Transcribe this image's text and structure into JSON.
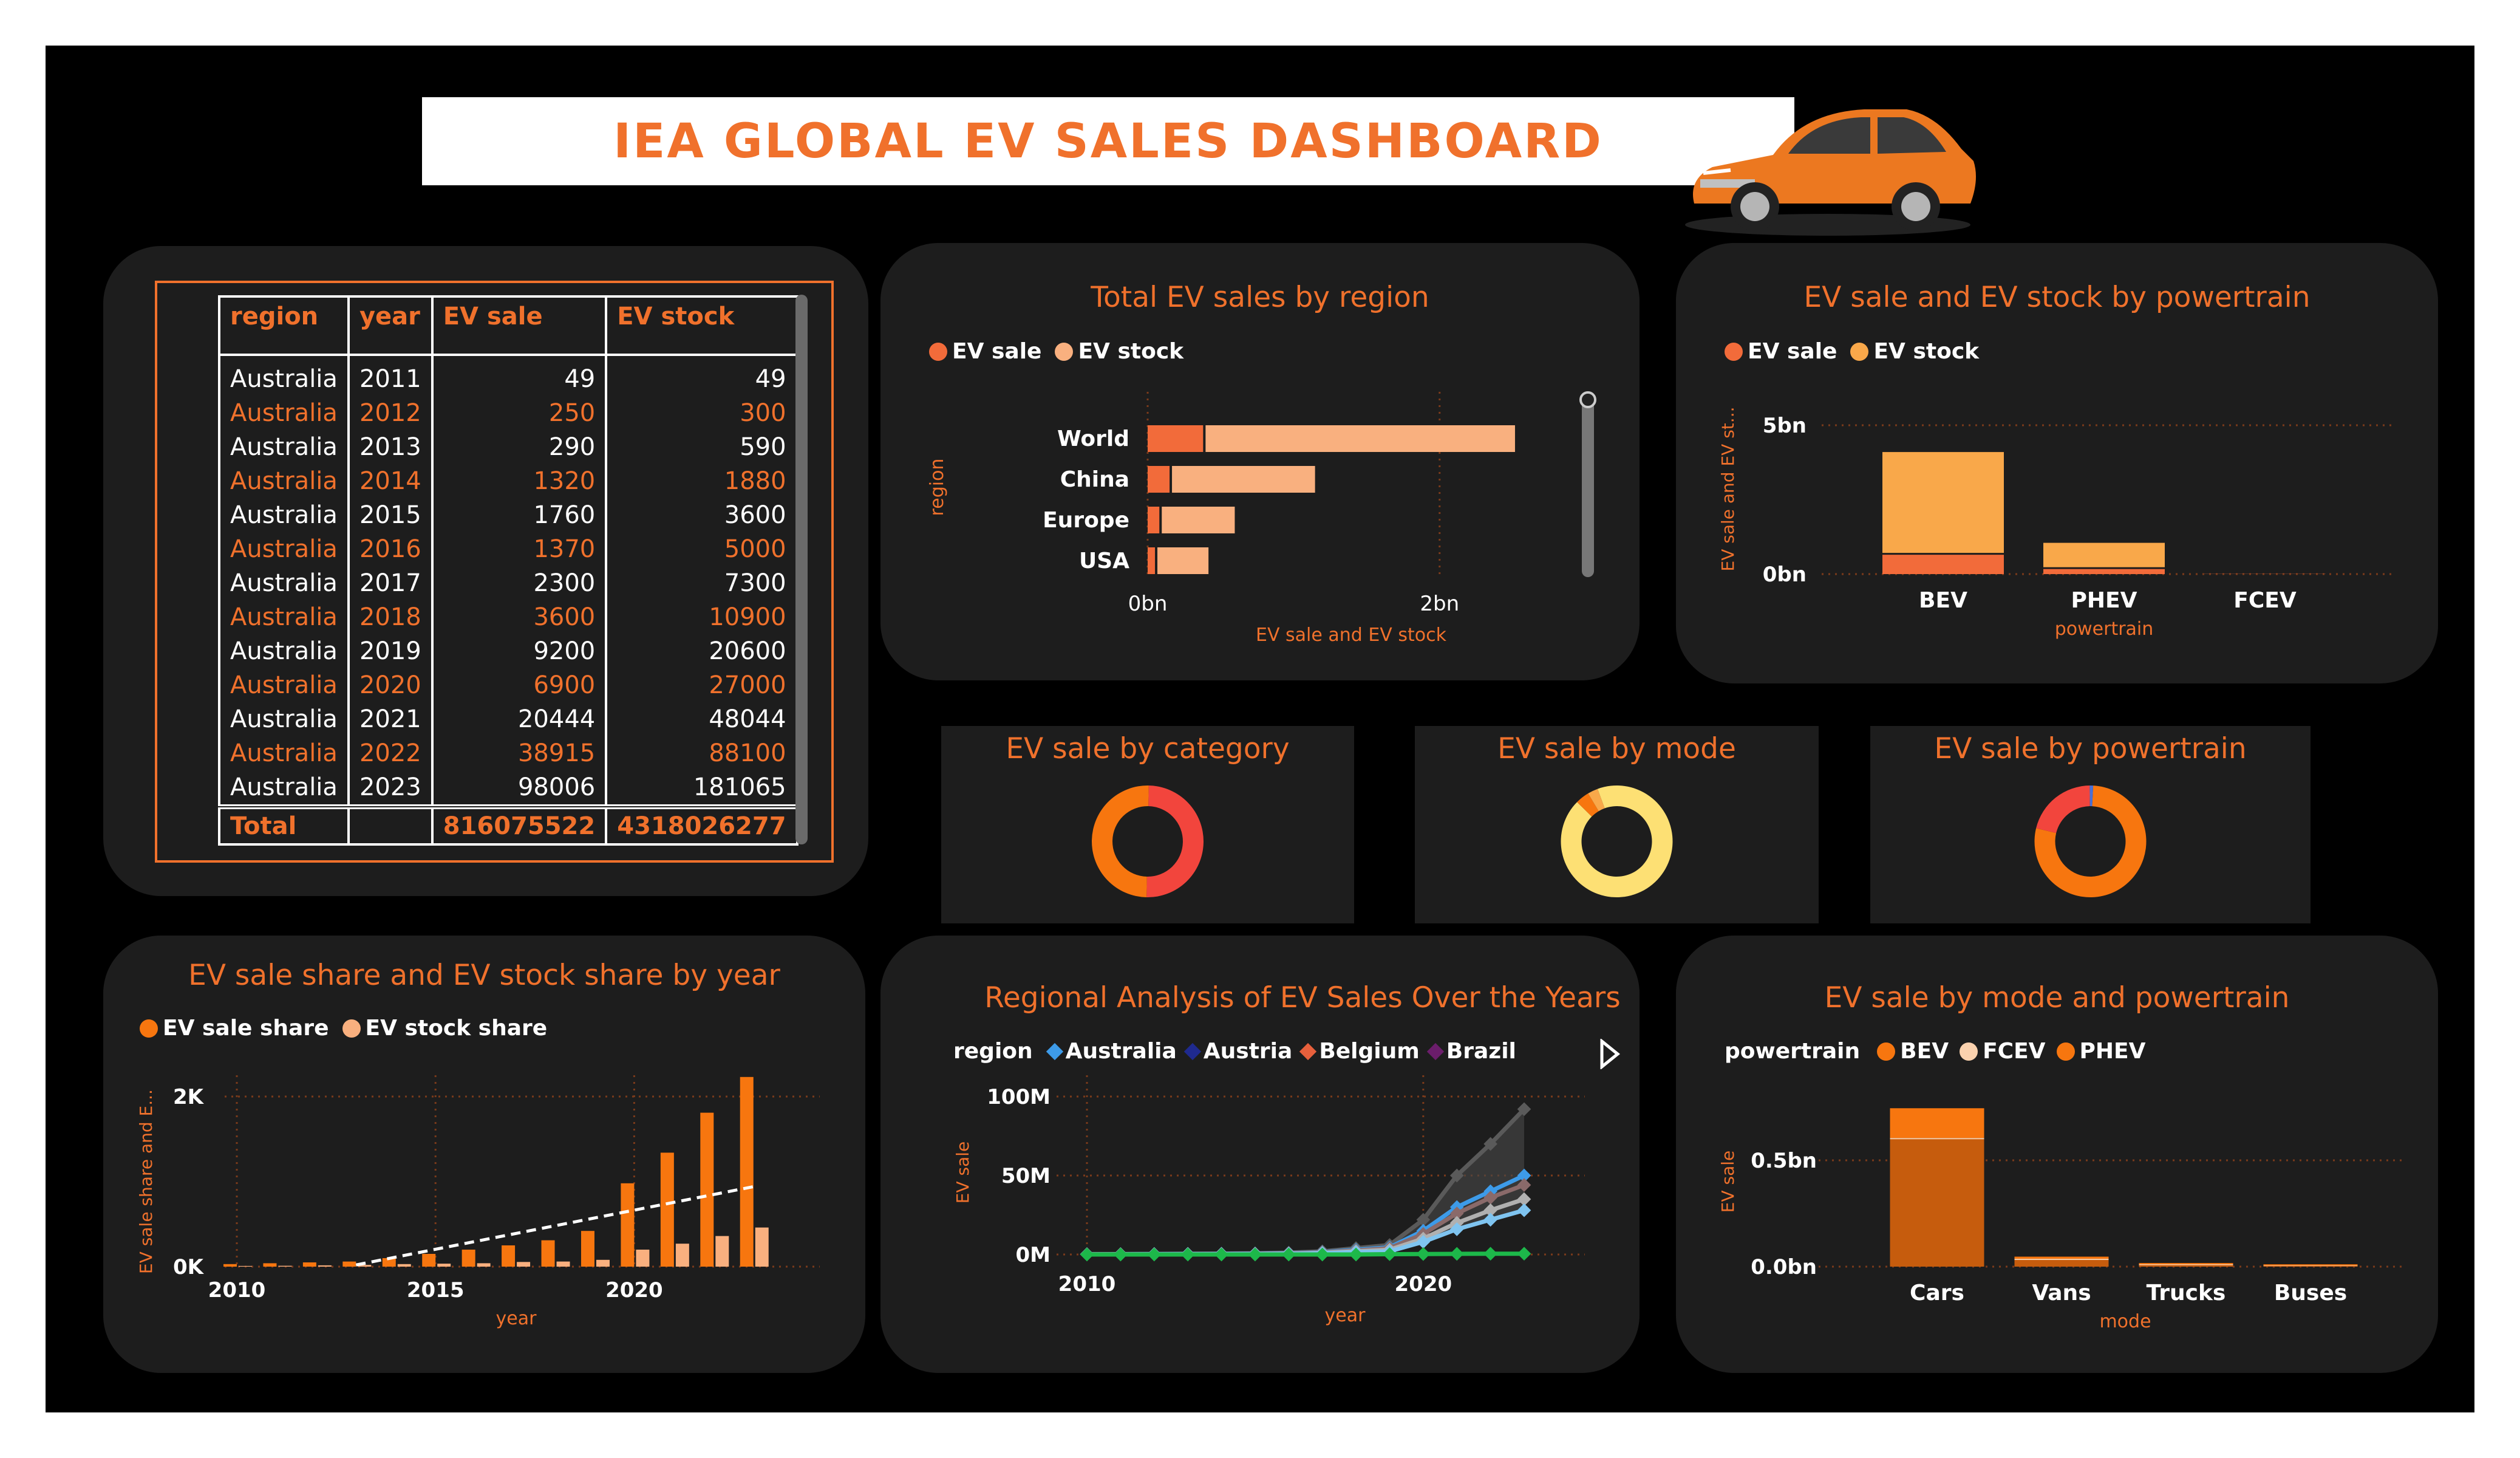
{
  "header": {
    "title": "IEA GLOBAL EV SALES DASHBOARD"
  },
  "colors": {
    "accent": "#f0712c",
    "panel": "#1d1d1d",
    "background": "#000000"
  },
  "table": {
    "columns": [
      "region",
      "year",
      "EV sale",
      "EV stock"
    ],
    "rows": [
      [
        "Australia",
        "2011",
        "49",
        "49"
      ],
      [
        "Australia",
        "2012",
        "250",
        "300"
      ],
      [
        "Australia",
        "2013",
        "290",
        "590"
      ],
      [
        "Australia",
        "2014",
        "1320",
        "1880"
      ],
      [
        "Australia",
        "2015",
        "1760",
        "3600"
      ],
      [
        "Australia",
        "2016",
        "1370",
        "5000"
      ],
      [
        "Australia",
        "2017",
        "2300",
        "7300"
      ],
      [
        "Australia",
        "2018",
        "3600",
        "10900"
      ],
      [
        "Australia",
        "2019",
        "9200",
        "20600"
      ],
      [
        "Australia",
        "2020",
        "6900",
        "27000"
      ],
      [
        "Australia",
        "2021",
        "20444",
        "48044"
      ],
      [
        "Australia",
        "2022",
        "38915",
        "88100"
      ],
      [
        "Australia",
        "2023",
        "98006",
        "181065"
      ]
    ],
    "total": {
      "label": "Total",
      "ev_sale": "816075522",
      "ev_stock": "4318026277"
    }
  },
  "chart_data": [
    {
      "id": "region",
      "type": "bar",
      "orientation": "horizontal",
      "title": "Total EV sales by region",
      "categories": [
        "World",
        "China",
        "Europe",
        "USA"
      ],
      "series": [
        {
          "name": "EV sale",
          "values": [
            0.38,
            0.15,
            0.08,
            0.05
          ],
          "color": "#f26b3a"
        },
        {
          "name": "EV stock",
          "values": [
            2.12,
            0.98,
            0.5,
            0.35
          ],
          "color": "#f9b07f"
        }
      ],
      "xlabel": "EV sale and EV stock",
      "ylabel": "region",
      "xlim": [
        0,
        2.6
      ],
      "xticks": [
        {
          "v": 0,
          "label": "0bn"
        },
        {
          "v": 2,
          "label": "2bn"
        }
      ]
    },
    {
      "id": "powertrain",
      "type": "bar",
      "title": "EV sale and EV stock by powertrain",
      "categories": [
        "BEV",
        "PHEV",
        "FCEV"
      ],
      "series": [
        {
          "name": "EV sale",
          "values": [
            0.65,
            0.17,
            0.005
          ],
          "color": "#f26b3a"
        },
        {
          "name": "EV stock",
          "values": [
            3.45,
            0.88,
            0.03
          ],
          "color": "#f9a84a"
        }
      ],
      "xlabel": "powertrain",
      "ylabel": "EV sale and EV st...",
      "ylim": [
        0,
        5
      ],
      "yticks": [
        {
          "v": 0,
          "label": "0bn"
        },
        {
          "v": 5,
          "label": "5bn"
        }
      ]
    },
    {
      "id": "category",
      "type": "pie",
      "title": "EV sale by category",
      "values": [
        50,
        50
      ],
      "colors": [
        "#f2453d",
        "#f7760f"
      ]
    },
    {
      "id": "mode",
      "type": "pie",
      "title": "EV sale by mode",
      "values": [
        93,
        4,
        3
      ],
      "colors": [
        "#fde074",
        "#f7760f",
        "#f9a84a"
      ]
    },
    {
      "id": "powertrain_donut",
      "type": "pie",
      "title": "EV sale by powertrain",
      "values": [
        78,
        21,
        1
      ],
      "colors": [
        "#f7760f",
        "#f2453d",
        "#4a6fd6"
      ]
    },
    {
      "id": "share",
      "type": "bar",
      "title": "EV sale share and EV stock share by year",
      "x": [
        2010,
        2011,
        2012,
        2013,
        2014,
        2015,
        2016,
        2017,
        2018,
        2019,
        2020,
        2021,
        2022,
        2023
      ],
      "series": [
        {
          "name": "EV sale share",
          "values": [
            30,
            40,
            50,
            60,
            100,
            150,
            200,
            250,
            310,
            420,
            980,
            1340,
            1810,
            2230
          ],
          "color": "#f7760f"
        },
        {
          "name": "EV stock share",
          "values": [
            8,
            10,
            15,
            20,
            30,
            35,
            40,
            55,
            60,
            80,
            200,
            270,
            360,
            460
          ],
          "color": "#f9b07f"
        }
      ],
      "trend": [
        [
          2013,
          20
        ],
        [
          2023,
          940
        ]
      ],
      "xlabel": "year",
      "ylabel": "EV sale share and E...",
      "ylim": [
        0,
        2500
      ],
      "yticks": [
        {
          "v": 0,
          "label": "0K"
        },
        {
          "v": 2000,
          "label": "2K"
        }
      ],
      "xticks": [
        2010,
        2015,
        2020
      ]
    },
    {
      "id": "regional",
      "type": "line",
      "title": "Regional Analysis of EV Sales Over the Years",
      "legend_title": "region",
      "legend": [
        {
          "name": "Australia",
          "color": "#3d9be9"
        },
        {
          "name": "Austria",
          "color": "#1f2a8f"
        },
        {
          "name": "Belgium",
          "color": "#e8603c"
        },
        {
          "name": "Brazil",
          "color": "#6b1d6b"
        }
      ],
      "x": [
        2010,
        2011,
        2012,
        2013,
        2014,
        2015,
        2016,
        2017,
        2018,
        2019,
        2020,
        2021,
        2022,
        2023
      ],
      "series": [
        {
          "values": [
            0.3,
            0.3,
            0.4,
            0.5,
            0.6,
            0.8,
            1.2,
            2,
            4,
            6,
            22,
            50,
            70,
            92
          ],
          "color": "#5a5a5a"
        },
        {
          "values": [
            0.2,
            0.2,
            0.3,
            0.4,
            0.5,
            0.6,
            0.9,
            1.5,
            3,
            4.5,
            15,
            30,
            40,
            50
          ],
          "color": "#3d9be9"
        },
        {
          "values": [
            0.2,
            0.2,
            0.3,
            0.3,
            0.4,
            0.5,
            0.8,
            1.3,
            2.5,
            4,
            13,
            26,
            36,
            44
          ],
          "color": "#8a6a6a"
        },
        {
          "values": [
            0.1,
            0.2,
            0.2,
            0.3,
            0.3,
            0.4,
            0.6,
            1,
            2,
            3,
            10,
            20,
            28,
            35
          ],
          "color": "#b0b0b0"
        },
        {
          "values": [
            0.1,
            0.1,
            0.2,
            0.2,
            0.2,
            0.3,
            0.5,
            0.8,
            1.5,
            2,
            8,
            16,
            22,
            28
          ],
          "color": "#7fc4f0"
        },
        {
          "values": [
            0,
            0,
            0,
            0,
            0,
            0,
            0,
            0,
            0,
            0.2,
            0.3,
            0.4,
            0.5,
            0.5
          ],
          "color": "#1db84a"
        }
      ],
      "xlabel": "year",
      "ylabel": "EV sale",
      "ylim": [
        0,
        100
      ],
      "yticks": [
        {
          "v": 0,
          "label": "0M"
        },
        {
          "v": 50,
          "label": "50M"
        },
        {
          "v": 100,
          "label": "100M"
        }
      ],
      "xticks": [
        2010,
        2020
      ]
    },
    {
      "id": "mode_powertrain",
      "type": "bar",
      "stacked": true,
      "title": "EV sale by mode and powertrain",
      "legend_title": "powertrain",
      "categories": [
        "Cars",
        "Vans",
        "Trucks",
        "Buses"
      ],
      "series": [
        {
          "name": "BEV",
          "values": [
            0.6,
            0.035,
            0.012,
            0.008
          ],
          "color": "#c65c0d"
        },
        {
          "name": "FCEV",
          "values": [
            0.005,
            0.002,
            0.001,
            0.001
          ],
          "color": "#fbd2ae"
        },
        {
          "name": "PHEV",
          "values": [
            0.14,
            0.01,
            0.004,
            0.002
          ],
          "color": "#f7760f"
        }
      ],
      "xlabel": "mode",
      "ylabel": "EV sale",
      "ylim": [
        0,
        0.75
      ],
      "yticks": [
        {
          "v": 0,
          "label": "0.0bn"
        },
        {
          "v": 0.5,
          "label": "0.5bn"
        }
      ]
    }
  ]
}
